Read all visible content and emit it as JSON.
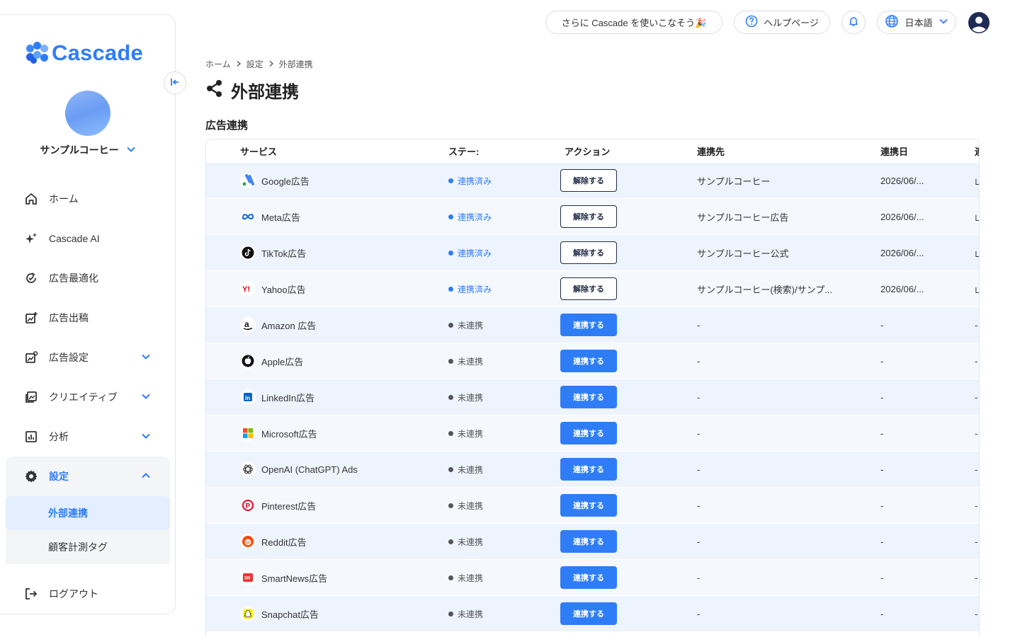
{
  "app": {
    "logo_text": "Cascade",
    "brand_color": "#2f7df6"
  },
  "sidebar": {
    "account_name": "サンプルコーヒー",
    "items": [
      {
        "label": "ホーム",
        "icon": "home-icon"
      },
      {
        "label": "Cascade AI",
        "icon": "sparkle-icon"
      },
      {
        "label": "広告最適化",
        "icon": "optimize-icon"
      },
      {
        "label": "広告出稿",
        "icon": "ad-publish-icon"
      },
      {
        "label": "広告設定",
        "icon": "ad-settings-icon"
      },
      {
        "label": "クリエイティブ",
        "icon": "image-icon"
      },
      {
        "label": "分析",
        "icon": "chart-icon"
      }
    ],
    "settings": {
      "label": "設定",
      "sub_items": [
        {
          "label": "外部連携"
        },
        {
          "label": "顧客計測タグ"
        }
      ]
    },
    "logout": "ログアウト"
  },
  "topbar": {
    "promo": "さらに Cascade を使いこなそう🎉",
    "help": "ヘルプページ",
    "language": "日本語"
  },
  "breadcrumb": [
    "ホーム",
    "設定",
    "外部連携"
  ],
  "page_title": "外部連携",
  "section_title": "広告連携",
  "table": {
    "headers": {
      "service": "サービス",
      "status": "ステー:",
      "action": "アクション",
      "destination": "連携先",
      "date": "連携日",
      "last": "連"
    },
    "rows": [
      {
        "service": "Google広告",
        "icon": "google-ads-icon",
        "status": "連携済み",
        "connected": true,
        "action": "解除する",
        "destination": "サンプルコーヒー",
        "date": "2026/06/...",
        "last": "山"
      },
      {
        "service": "Meta広告",
        "icon": "meta-icon",
        "status": "連携済み",
        "connected": true,
        "action": "解除する",
        "destination": "サンプルコーヒー広告",
        "date": "2026/06/...",
        "last": "山"
      },
      {
        "service": "TikTok広告",
        "icon": "tiktok-icon",
        "status": "連携済み",
        "connected": true,
        "action": "解除する",
        "destination": "サンプルコーヒー公式",
        "date": "2026/06/...",
        "last": "山"
      },
      {
        "service": "Yahoo広告",
        "icon": "yahoo-icon",
        "status": "連携済み",
        "connected": true,
        "action": "解除する",
        "destination": "サンプルコーヒー(検索)/サンプ...",
        "date": "2026/06/...",
        "last": "山"
      },
      {
        "service": "Amazon 広告",
        "icon": "amazon-icon",
        "status": "未連携",
        "connected": false,
        "action": "連携する",
        "destination": "-",
        "date": "-",
        "last": "-"
      },
      {
        "service": "Apple広告",
        "icon": "apple-icon",
        "status": "未連携",
        "connected": false,
        "action": "連携する",
        "destination": "-",
        "date": "-",
        "last": "-"
      },
      {
        "service": "LinkedIn広告",
        "icon": "linkedin-icon",
        "status": "未連携",
        "connected": false,
        "action": "連携する",
        "destination": "-",
        "date": "-",
        "last": "-"
      },
      {
        "service": "Microsoft広告",
        "icon": "microsoft-icon",
        "status": "未連携",
        "connected": false,
        "action": "連携する",
        "destination": "-",
        "date": "-",
        "last": "-"
      },
      {
        "service": "OpenAI (ChatGPT) Ads",
        "icon": "openai-icon",
        "status": "未連携",
        "connected": false,
        "action": "連携する",
        "destination": "-",
        "date": "-",
        "last": "-"
      },
      {
        "service": "Pinterest広告",
        "icon": "pinterest-icon",
        "status": "未連携",
        "connected": false,
        "action": "連携する",
        "destination": "-",
        "date": "-",
        "last": "-"
      },
      {
        "service": "Reddit広告",
        "icon": "reddit-icon",
        "status": "未連携",
        "connected": false,
        "action": "連携する",
        "destination": "-",
        "date": "-",
        "last": "-"
      },
      {
        "service": "SmartNews広告",
        "icon": "smartnews-icon",
        "status": "未連携",
        "connected": false,
        "action": "連携する",
        "destination": "-",
        "date": "-",
        "last": "-"
      },
      {
        "service": "Snapchat広告",
        "icon": "snapchat-icon",
        "status": "未連携",
        "connected": false,
        "action": "連携する",
        "destination": "-",
        "date": "-",
        "last": "-"
      }
    ]
  }
}
